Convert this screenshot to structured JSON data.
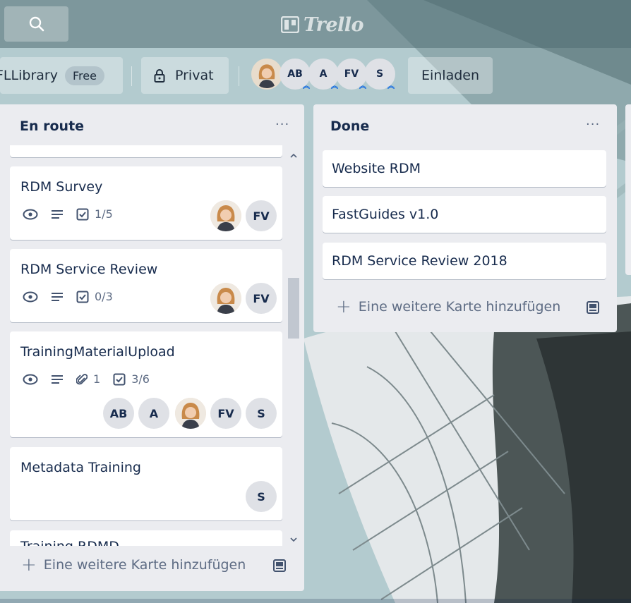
{
  "header": {
    "logo_text": "Trello"
  },
  "board": {
    "name": "FLLibrary",
    "plan_badge": "Free",
    "visibility": "Privat",
    "members": [
      "",
      "AB",
      "A",
      "FV",
      "S"
    ],
    "invite_label": "Einladen"
  },
  "lists": [
    {
      "title": "En route",
      "menu": "···",
      "cards": [
        {
          "title": "RDM Survey",
          "checklist": "1/5",
          "members": [
            "",
            "FV"
          ]
        },
        {
          "title": "RDM Service Review",
          "checklist": "0/3",
          "members": [
            "",
            "FV"
          ]
        },
        {
          "title": "TrainingMaterialUpload",
          "attachments": "1",
          "checklist": "3/6",
          "members": [
            "AB",
            "A",
            "",
            "FV",
            "S"
          ]
        },
        {
          "title": "Metadata Training",
          "members": [
            "S"
          ]
        },
        {
          "title": "Training RDMD"
        }
      ],
      "add_card_label": "Eine weitere Karte hinzufügen"
    },
    {
      "title": "Done",
      "menu": "···",
      "cards": [
        {
          "title": "Website RDM"
        },
        {
          "title": "FastGuides v1.0"
        },
        {
          "title": "RDM Service Review 2018"
        }
      ],
      "add_card_label": "Eine weitere Karte hinzufügen"
    }
  ],
  "icons": {
    "search": "search-icon",
    "logo": "trello-logo-icon",
    "lock": "lock-icon",
    "watch": "eye-icon",
    "description": "description-icon",
    "checklist": "checklist-icon",
    "attachment": "paperclip-icon",
    "template": "card-template-icon"
  },
  "colors": {
    "list_bg": "#ebecf0",
    "text": "#172b4d",
    "muted": "#5e6c84",
    "member_badge": "#dfe1e6"
  }
}
